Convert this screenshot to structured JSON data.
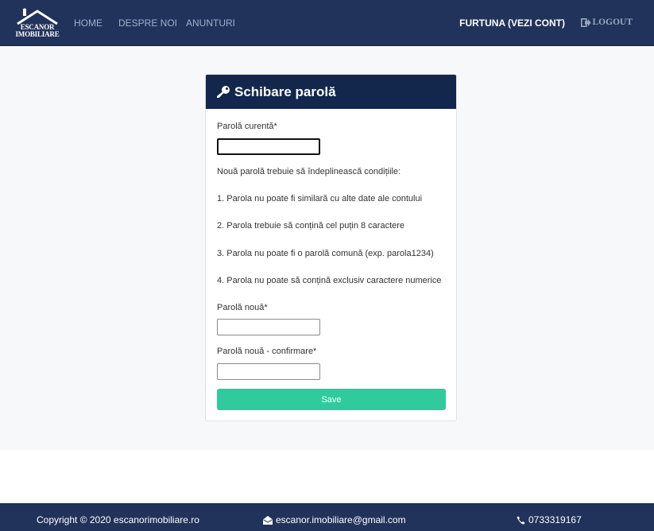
{
  "nav": {
    "logo_line1": "ESCANOR",
    "logo_line2": "IMOBILIARE",
    "links": [
      "HOME",
      "DESPRE NOI",
      "ANUNTURI"
    ],
    "user": "FURTUNA (VEZI CONT)",
    "logout": "LOGOUT"
  },
  "card": {
    "title": "Schibare parolă",
    "current_label": "Parolă curentă*",
    "rules_intro": "Nouă parolă trebuie să îndeplinească condițiile:",
    "rules": [
      "1. Parola nu poate fi similară cu alte date ale contului",
      "2. Parola trebuie să conțină cel puțin 8 caractere",
      "3. Parola nu poate fi o parolă comună (exp. parola1234)",
      "4. Parola nu poate să conțină exclusiv caractere numerice"
    ],
    "new_label": "Parolă nouă*",
    "confirm_label": "Parolă nouă - confirmare*",
    "save_label": "Save"
  },
  "footer": {
    "copyright": "Copyright © 2020 escanorimobiliare.ro",
    "email": "escanor.imobiliare@gmail.com",
    "phone": "0733319167"
  },
  "colors": {
    "navbar": "#21335a",
    "card_header": "#13274d",
    "save_button": "#2fcb9d",
    "background": "#f7f8fa"
  }
}
